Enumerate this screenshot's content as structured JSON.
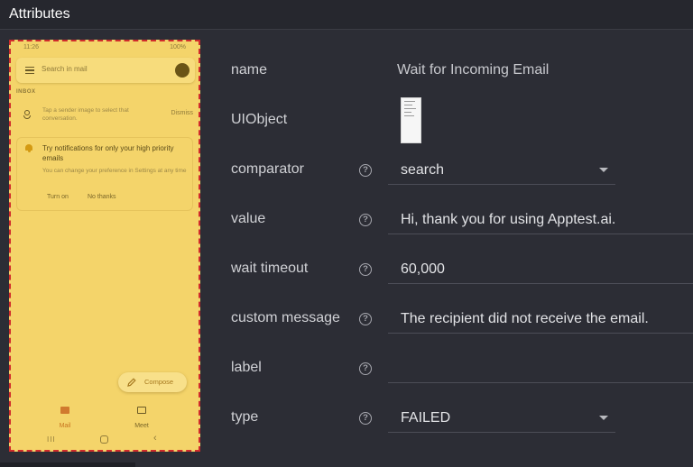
{
  "header": {
    "title": "Attributes"
  },
  "phone": {
    "status_time": "11:26",
    "status_right": "100%",
    "search_placeholder": "Search in mail",
    "inbox_label": "INBOX",
    "tip_text": "Tap a sender image to select that conversation.",
    "tip_dismiss": "Dismiss",
    "card_title": "Try notifications for only your high priority emails",
    "card_sub": "You can change your preference in Settings at any time",
    "card_turn_on": "Turn on",
    "card_no_thanks": "No thanks",
    "compose_label": "Compose",
    "nav_mail": "Mail",
    "nav_meet": "Meet",
    "colors": {
      "highlight": "#f4d46a",
      "outline": "#d02b2b"
    }
  },
  "attributes": {
    "name": {
      "label": "name",
      "value": "Wait for Incoming Email"
    },
    "uiobject": {
      "label": "UIObject"
    },
    "comparator": {
      "label": "comparator",
      "value": "search"
    },
    "value": {
      "label": "value",
      "value": "Hi, thank you for using Apptest.ai."
    },
    "wait_timeout": {
      "label": "wait timeout",
      "value": "60,000"
    },
    "custom_message": {
      "label": "custom message",
      "value": "The recipient did not receive the email."
    },
    "label_field": {
      "label": "label",
      "value": ""
    },
    "type": {
      "label": "type",
      "value": "FAILED"
    }
  },
  "icons": {
    "help": "?"
  }
}
